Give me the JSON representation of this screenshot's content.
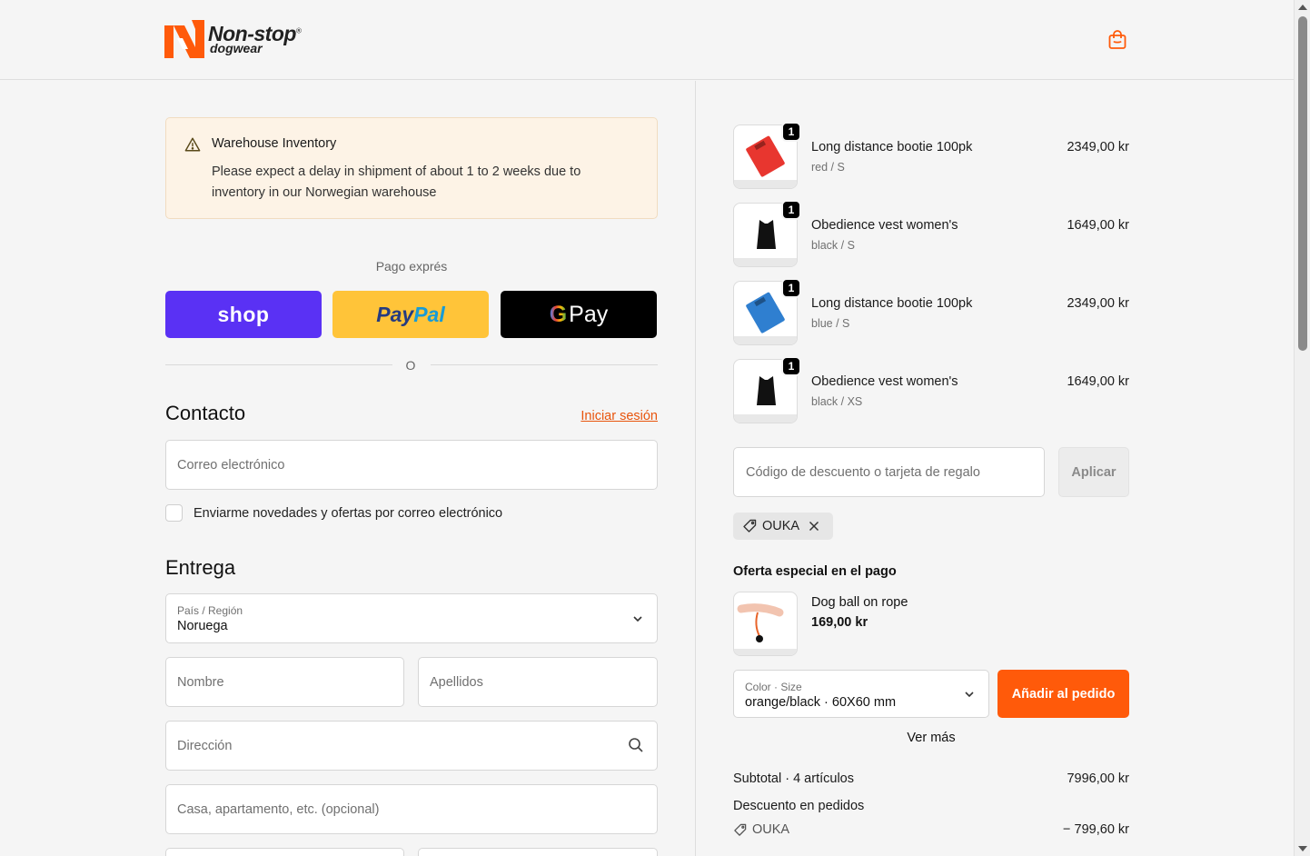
{
  "header": {
    "logo_name": "Non-stop",
    "logo_sub": "dogwear"
  },
  "notice": {
    "title": "Warehouse Inventory",
    "body": "Please expect a delay in shipment of about 1 to 2 weeks due to inventory in our Norwegian warehouse"
  },
  "express": {
    "label": "Pago exprés",
    "shop_label": "shop",
    "paypal_label_1": "Pay",
    "paypal_label_2": "Pal",
    "gpay_g": "G",
    "gpay_label": "Pay",
    "or_label": "O"
  },
  "contact": {
    "title": "Contacto",
    "login_link": "Iniciar sesión",
    "email_placeholder": "Correo electrónico",
    "newsletter_label": "Enviarme novedades y ofertas por correo electrónico"
  },
  "delivery": {
    "title": "Entrega",
    "country_label": "País / Región",
    "country_value": "Noruega",
    "first_name_placeholder": "Nombre",
    "last_name_placeholder": "Apellidos",
    "address_placeholder": "Dirección",
    "address2_placeholder": "Casa, apartamento, etc. (opcional)"
  },
  "cart": {
    "items": [
      {
        "qty": "1",
        "name": "Long distance bootie 100pk",
        "variant": "red / S",
        "price": "2349,00 kr",
        "color": "#e8362f"
      },
      {
        "qty": "1",
        "name": "Obedience vest women's",
        "variant": "black / S",
        "price": "1649,00 kr",
        "color": "#111111"
      },
      {
        "qty": "1",
        "name": "Long distance bootie 100pk",
        "variant": "blue / S",
        "price": "2349,00 kr",
        "color": "#2f7fd0"
      },
      {
        "qty": "1",
        "name": "Obedience vest women's",
        "variant": "black / XS",
        "price": "1649,00 kr",
        "color": "#111111"
      }
    ]
  },
  "discount": {
    "placeholder": "Código de descuento o tarjeta de regalo",
    "apply_label": "Aplicar",
    "applied_code": "OUKA"
  },
  "offer": {
    "title": "Oferta especial en el pago",
    "name": "Dog ball on rope",
    "price": "169,00 kr",
    "option_label": "Color · Size",
    "option_value": "orange/black · 60X60 mm",
    "add_label": "Añadir al pedido",
    "see_more": "Ver más"
  },
  "summary": {
    "subtotal_label": "Subtotal · 4 artículos",
    "subtotal_value": "7996,00 kr",
    "discount_label": "Descuento en pedidos",
    "discount_code": "OUKA",
    "discount_value": "− 799,60 kr"
  },
  "colors": {
    "accent": "#ff5a0a",
    "shop": "#5a31f4",
    "paypal": "#ffc439"
  }
}
